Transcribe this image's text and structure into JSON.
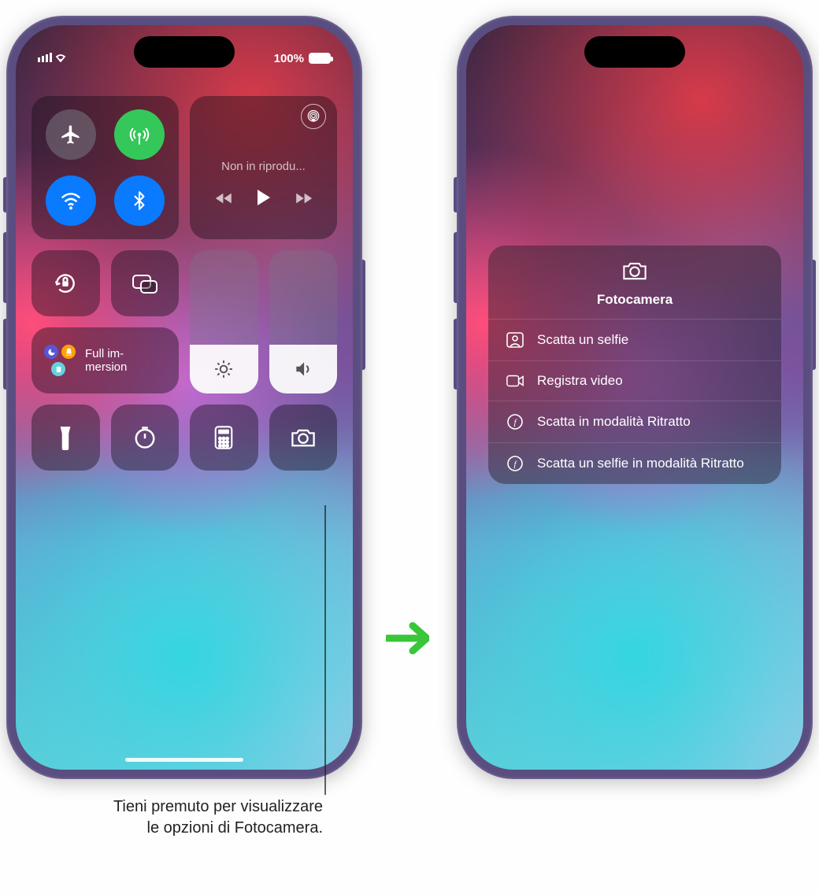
{
  "status": {
    "battery_pct": "100%"
  },
  "music": {
    "now_playing": "Non in riprodu..."
  },
  "focus": {
    "label": "Full im-\nmersion"
  },
  "camera_menu": {
    "title": "Fotocamera",
    "items": [
      "Scatta un selfie",
      "Registra video",
      "Scatta in modalità Ritratto",
      "Scatta un selfie in modalità Ritratto"
    ]
  },
  "caption": "Tieni premuto per visualizzare le opzioni di Fotocamera."
}
